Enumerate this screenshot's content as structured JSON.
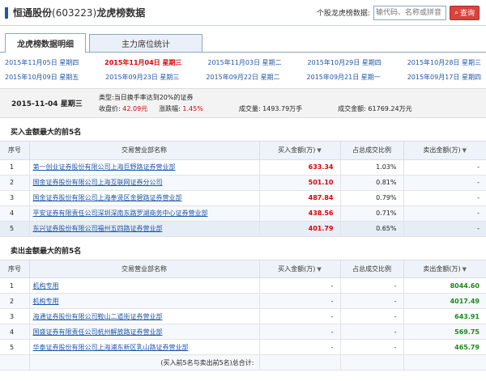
{
  "header": {
    "stock_name": "恒通股份",
    "stock_code": "(603223)",
    "title_suffix": "龙虎榜数据",
    "search_label": "个股龙虎榜数据:",
    "search_placeholder": "输代码、名称或拼音",
    "search_button": "查询"
  },
  "tabs": [
    "龙虎榜数据明细",
    "主力席位统计"
  ],
  "dates": [
    [
      "2015年11月05日 星期四",
      "2015年11月04日 星期三",
      "2015年11月03日 星期二",
      "2015年10月29日 星期四",
      "2015年10月28日 星期三"
    ],
    [
      "2015年10月09日 星期五",
      "2015年09月23日 星期三",
      "2015年09月22日 星期二",
      "2015年09月21日 星期一",
      "2015年09月17日 星期四"
    ]
  ],
  "info": {
    "date": "2015-11-04 星期三",
    "type_label": "类型:",
    "type_value": "当日换手率达到20%的证券",
    "close_label": "收盘价:",
    "close_value": "42.09元",
    "change_label": "涨跌幅:",
    "change_value": "1.45%",
    "volume_label": "成交量:",
    "volume_value": "1493.79万手",
    "amount_label": "成交金额:",
    "amount_value": "61769.24万元"
  },
  "columns": {
    "no": "序号",
    "dept": "交易营业部名称",
    "buy": "买入金额(万)",
    "ratio": "占总成交比例",
    "sell": "卖出金额(万)"
  },
  "buy_section": {
    "title": "买入金额最大的前5名",
    "rows": [
      {
        "no": "1",
        "dept": "第一创业证券股份有限公司上海巨野路证券营业部",
        "buy": "633.34",
        "ratio": "1.03%",
        "sell": "-"
      },
      {
        "no": "2",
        "dept": "国金证券股份有限公司上海互联网证券分公司",
        "buy": "501.10",
        "ratio": "0.81%",
        "sell": "-"
      },
      {
        "no": "3",
        "dept": "国金证券股份有限公司上海奉贤区金碧路证券营业部",
        "buy": "487.84",
        "ratio": "0.79%",
        "sell": "-"
      },
      {
        "no": "4",
        "dept": "平安证券有限责任公司深圳深南东路罗湖商务中心证券营业部",
        "buy": "438.56",
        "ratio": "0.71%",
        "sell": "-"
      },
      {
        "no": "5",
        "dept": "东兴证券股份有限公司福州五四路证券营业部",
        "buy": "401.79",
        "ratio": "0.65%",
        "sell": "-"
      }
    ]
  },
  "sell_section": {
    "title": "卖出金额最大的前5名",
    "rows": [
      {
        "no": "1",
        "dept": "机构专用",
        "buy": "-",
        "ratio": "-",
        "sell": "8044.60"
      },
      {
        "no": "2",
        "dept": "机构专用",
        "buy": "-",
        "ratio": "-",
        "sell": "4017.49"
      },
      {
        "no": "3",
        "dept": "海通证券股份有限公司鞍山二道街证券营业部",
        "buy": "-",
        "ratio": "-",
        "sell": "643.91"
      },
      {
        "no": "4",
        "dept": "国盛证券有限责任公司杭州解放路证券营业部",
        "buy": "-",
        "ratio": "-",
        "sell": "569.75"
      },
      {
        "no": "5",
        "dept": "华泰证券股份有限公司上海浦东新区乳山路证券营业部",
        "buy": "-",
        "ratio": "-",
        "sell": "465.79"
      }
    ],
    "total_label": "(买入前5名与卖出前5名)总合计:"
  }
}
